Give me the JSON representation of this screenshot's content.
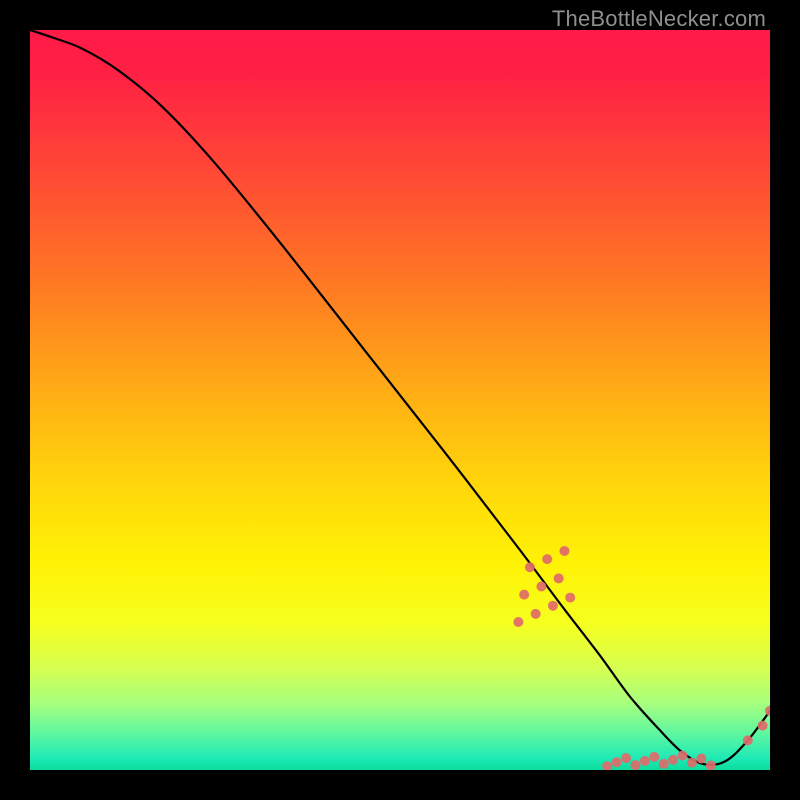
{
  "watermark": "TheBottleNecker.com",
  "chart_data": {
    "type": "line",
    "title": "",
    "xlabel": "",
    "ylabel": "",
    "xlim": [
      0,
      100
    ],
    "ylim": [
      0,
      100
    ],
    "gradient_stops": [
      {
        "offset": 0.0,
        "color": "#ff1a47"
      },
      {
        "offset": 0.06,
        "color": "#ff2144"
      },
      {
        "offset": 0.2,
        "color": "#ff4b34"
      },
      {
        "offset": 0.35,
        "color": "#ff7b22"
      },
      {
        "offset": 0.5,
        "color": "#ffb114"
      },
      {
        "offset": 0.62,
        "color": "#ffd80a"
      },
      {
        "offset": 0.72,
        "color": "#fff205"
      },
      {
        "offset": 0.8,
        "color": "#f6ff1e"
      },
      {
        "offset": 0.86,
        "color": "#d8ff4e"
      },
      {
        "offset": 0.91,
        "color": "#a6ff7e"
      },
      {
        "offset": 0.95,
        "color": "#60f7a0"
      },
      {
        "offset": 0.985,
        "color": "#1de9b6"
      },
      {
        "offset": 1.0,
        "color": "#0bdc9b"
      }
    ],
    "series": [
      {
        "name": "bottleneck-curve",
        "x": [
          0,
          3,
          7,
          12,
          18,
          25,
          34,
          45,
          56,
          66,
          72,
          77,
          81,
          85,
          88,
          91,
          94,
          97,
          100
        ],
        "y": [
          100,
          99,
          97.5,
          94.5,
          89.5,
          82,
          71,
          57,
          43,
          30,
          22,
          15.5,
          10,
          5.5,
          2.5,
          0.8,
          1.2,
          4,
          8
        ]
      }
    ],
    "marker_clusters": [
      {
        "name": "cluster-upper",
        "x_range": [
          66,
          73
        ],
        "y_range": [
          20,
          30
        ],
        "count": 10,
        "color": "#e06a6a",
        "r": 5
      },
      {
        "name": "cluster-lower",
        "x_range": [
          78,
          92
        ],
        "y_range": [
          0.5,
          2.0
        ],
        "count": 12,
        "color": "#e06a6a",
        "r": 5
      },
      {
        "name": "tail-points",
        "points": [
          [
            97,
            4
          ],
          [
            99,
            6
          ],
          [
            100,
            8
          ]
        ],
        "color": "#e06a6a",
        "r": 5
      }
    ]
  }
}
